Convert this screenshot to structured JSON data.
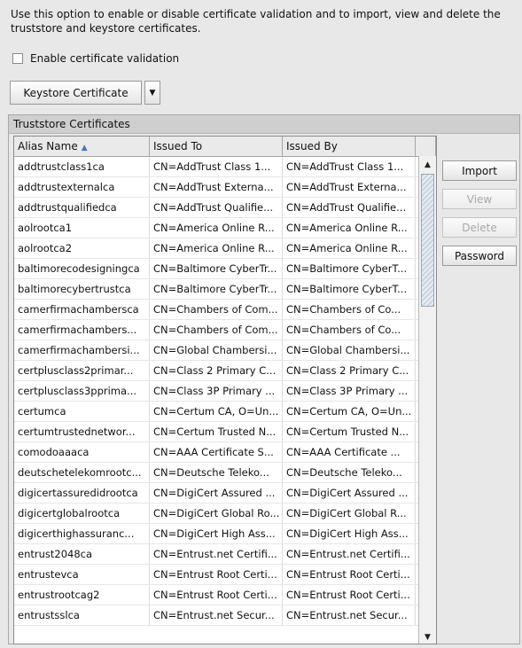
{
  "description": "Use this option to enable or disable certificate validation and to import, view and delete the truststore and keystore certificates.",
  "enable_checkbox": {
    "label": "Enable certificate validation",
    "checked": false
  },
  "keystore_dropdown": {
    "value": "Keystore Certificate"
  },
  "panel": {
    "title": "Truststore Certificates"
  },
  "table": {
    "headers": [
      "Alias Name",
      "Issued To",
      "Issued By"
    ],
    "rows": [
      [
        "addtrustclass1ca",
        "CN=AddTrust Class 1...",
        "CN=AddTrust Class 1..."
      ],
      [
        "addtrustexternalca",
        "CN=AddTrust Externa...",
        "CN=AddTrust Externa..."
      ],
      [
        "addtrustqualifiedca",
        "CN=AddTrust Qualifie...",
        "CN=AddTrust Qualifie..."
      ],
      [
        "aolrootca1",
        "CN=America Online R...",
        "CN=America Online R..."
      ],
      [
        "aolrootca2",
        "CN=America Online R...",
        "CN=America Online R..."
      ],
      [
        "baltimorecodesigningca",
        "CN=Baltimore CyberTr...",
        "CN=Baltimore CyberT..."
      ],
      [
        "baltimorecybertrustca",
        "CN=Baltimore CyberTr...",
        "CN=Baltimore CyberT..."
      ],
      [
        "camerfirmachambersca",
        "CN=Chambers of Com...",
        "CN=Chambers of Co..."
      ],
      [
        "camerfirmachambers...",
        "CN=Chambers of Com...",
        "CN=Chambers of Co..."
      ],
      [
        "camerfirmachambersi...",
        "CN=Global Chambersi...",
        "CN=Global Chambersi..."
      ],
      [
        "certplusclass2primar...",
        "CN=Class 2 Primary C...",
        "CN=Class 2 Primary C..."
      ],
      [
        "certplusclass3pprima...",
        "CN=Class 3P Primary ...",
        "CN=Class 3P Primary ..."
      ],
      [
        "certumca",
        "CN=Certum CA, O=Un...",
        "CN=Certum CA, O=Un..."
      ],
      [
        "certumtrustednetwor...",
        "CN=Certum Trusted N...",
        "CN=Certum Trusted N..."
      ],
      [
        "comodoaaaca",
        "CN=AAA Certificate S...",
        "CN=AAA Certificate ..."
      ],
      [
        "deutschetelekomrootc...",
        "CN=Deutsche Teleko...",
        "CN=Deutsche Teleko..."
      ],
      [
        "digicertassuredidrootca",
        "CN=DigiCert Assured ...",
        "CN=DigiCert Assured ..."
      ],
      [
        "digicertglobalrootca",
        "CN=DigiCert Global Ro...",
        "CN=DigiCert Global R..."
      ],
      [
        "digicerthighassuranc...",
        "CN=DigiCert High Ass...",
        "CN=DigiCert High Ass..."
      ],
      [
        "entrust2048ca",
        "CN=Entrust.net Certifi...",
        "CN=Entrust.net Certifi..."
      ],
      [
        "entrustevca",
        "CN=Entrust Root Certi...",
        "CN=Entrust Root Certi..."
      ],
      [
        "entrustrootcag2",
        "CN=Entrust Root Certi...",
        "CN=Entrust Root Certi..."
      ],
      [
        "entrustsslca",
        "CN=Entrust.net Secur...",
        "CN=Entrust.net Secur..."
      ]
    ]
  },
  "buttons": {
    "import": "Import",
    "view": "View",
    "delete": "Delete",
    "password": "Password"
  },
  "icons": {
    "sort": "sort-ascending-icon",
    "dropdown": "chevron-down-icon",
    "scroll_up": "scroll-up-arrow-icon",
    "scroll_down": "scroll-down-arrow-icon"
  },
  "colors": {
    "background": "#e8e8e8",
    "panel_title_bg": "#cfcfcf",
    "table_header_bg": "#eaeaea",
    "sort_icon": "#4a74b8"
  }
}
